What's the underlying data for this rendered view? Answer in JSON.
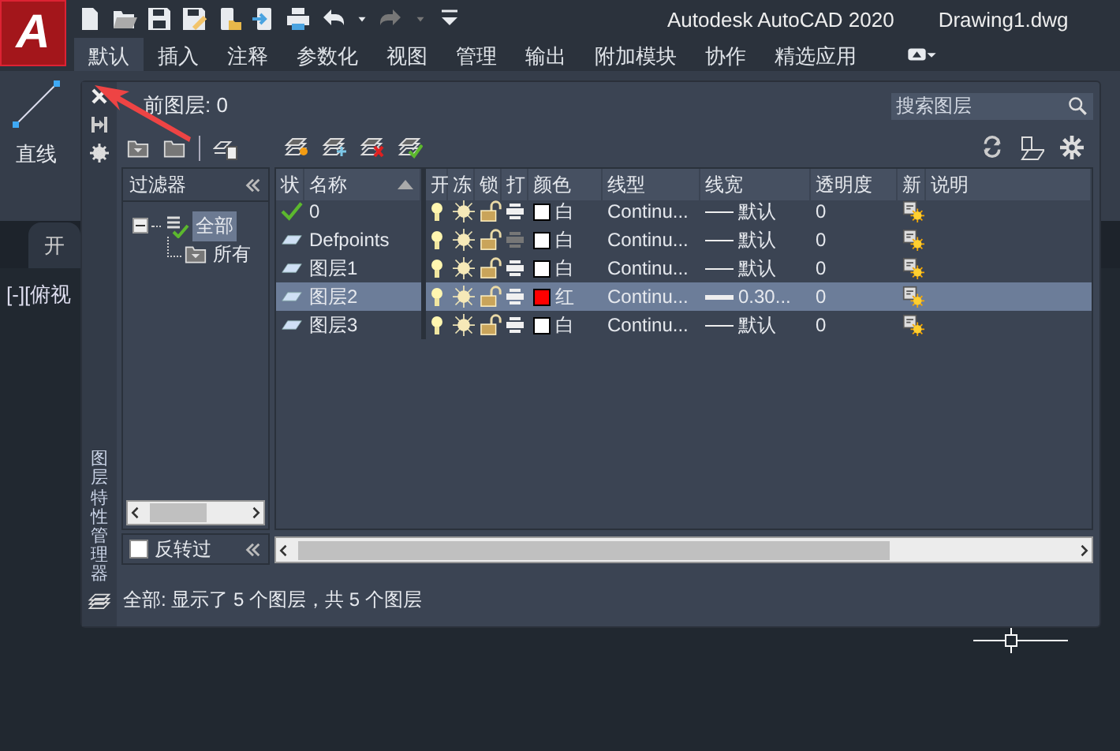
{
  "logo": "A",
  "title": "Autodesk AutoCAD 2020",
  "document": "Drawing1.dwg",
  "ribbon_tabs": [
    {
      "label": "默认",
      "selected": true
    },
    {
      "label": "插入",
      "selected": false
    },
    {
      "label": "注释",
      "selected": false
    },
    {
      "label": "参数化",
      "selected": false
    },
    {
      "label": "视图",
      "selected": false
    },
    {
      "label": "管理",
      "selected": false
    },
    {
      "label": "输出",
      "selected": false
    },
    {
      "label": "附加模块",
      "selected": false
    },
    {
      "label": "协作",
      "selected": false
    },
    {
      "label": "精选应用",
      "selected": false
    }
  ],
  "ribbon_tools": [
    {
      "label": "直线"
    }
  ],
  "file_tabs": [
    {
      "label": "开"
    }
  ],
  "viewport_label": "[-][俯视",
  "palette": {
    "side_title": "图层特性管理器",
    "current_layer": "前图层: 0",
    "search": {
      "placeholder": "搜索图层"
    },
    "filters": {
      "header": "过滤器",
      "tree": [
        {
          "label": "全部",
          "selected": true,
          "children": [
            {
              "label": "所有",
              "selected": false
            }
          ]
        }
      ],
      "invert": {
        "label": "反转过",
        "checked": false
      }
    },
    "columns": [
      {
        "label": "状"
      },
      {
        "label": "名称"
      },
      {
        "label": "开"
      },
      {
        "label": "冻"
      },
      {
        "label": "锁"
      },
      {
        "label": "打"
      },
      {
        "label": "颜色"
      },
      {
        "label": "线型"
      },
      {
        "label": "线宽"
      },
      {
        "label": "透明度"
      },
      {
        "label": "新"
      },
      {
        "label": "说明"
      }
    ],
    "layers": [
      {
        "name": "0",
        "current": true,
        "selected": false,
        "on": true,
        "frozen": false,
        "locked": false,
        "plot": true,
        "color": "#ffffff",
        "color_name": "白",
        "linetype": "Continu...",
        "heavy_line": false,
        "lineweight": "默认",
        "transparency": "0"
      },
      {
        "name": "Defpoints",
        "current": false,
        "selected": false,
        "on": true,
        "frozen": false,
        "locked": false,
        "plot": false,
        "color": "#ffffff",
        "color_name": "白",
        "linetype": "Continu...",
        "heavy_line": false,
        "lineweight": "默认",
        "transparency": "0"
      },
      {
        "name": "图层1",
        "current": false,
        "selected": false,
        "on": true,
        "frozen": false,
        "locked": false,
        "plot": true,
        "color": "#ffffff",
        "color_name": "白",
        "linetype": "Continu...",
        "heavy_line": false,
        "lineweight": "默认",
        "transparency": "0"
      },
      {
        "name": "图层2",
        "current": false,
        "selected": true,
        "on": true,
        "frozen": false,
        "locked": false,
        "plot": true,
        "color": "#ff0000",
        "color_name": "红",
        "linetype": "Continu...",
        "heavy_line": true,
        "lineweight": "0.30...",
        "transparency": "0"
      },
      {
        "name": "图层3",
        "current": false,
        "selected": false,
        "on": true,
        "frozen": false,
        "locked": false,
        "plot": true,
        "color": "#ffffff",
        "color_name": "白",
        "linetype": "Continu...",
        "heavy_line": false,
        "lineweight": "默认",
        "transparency": "0"
      }
    ],
    "status": "全部: 显示了 5 个图层，共 5 个图层"
  }
}
